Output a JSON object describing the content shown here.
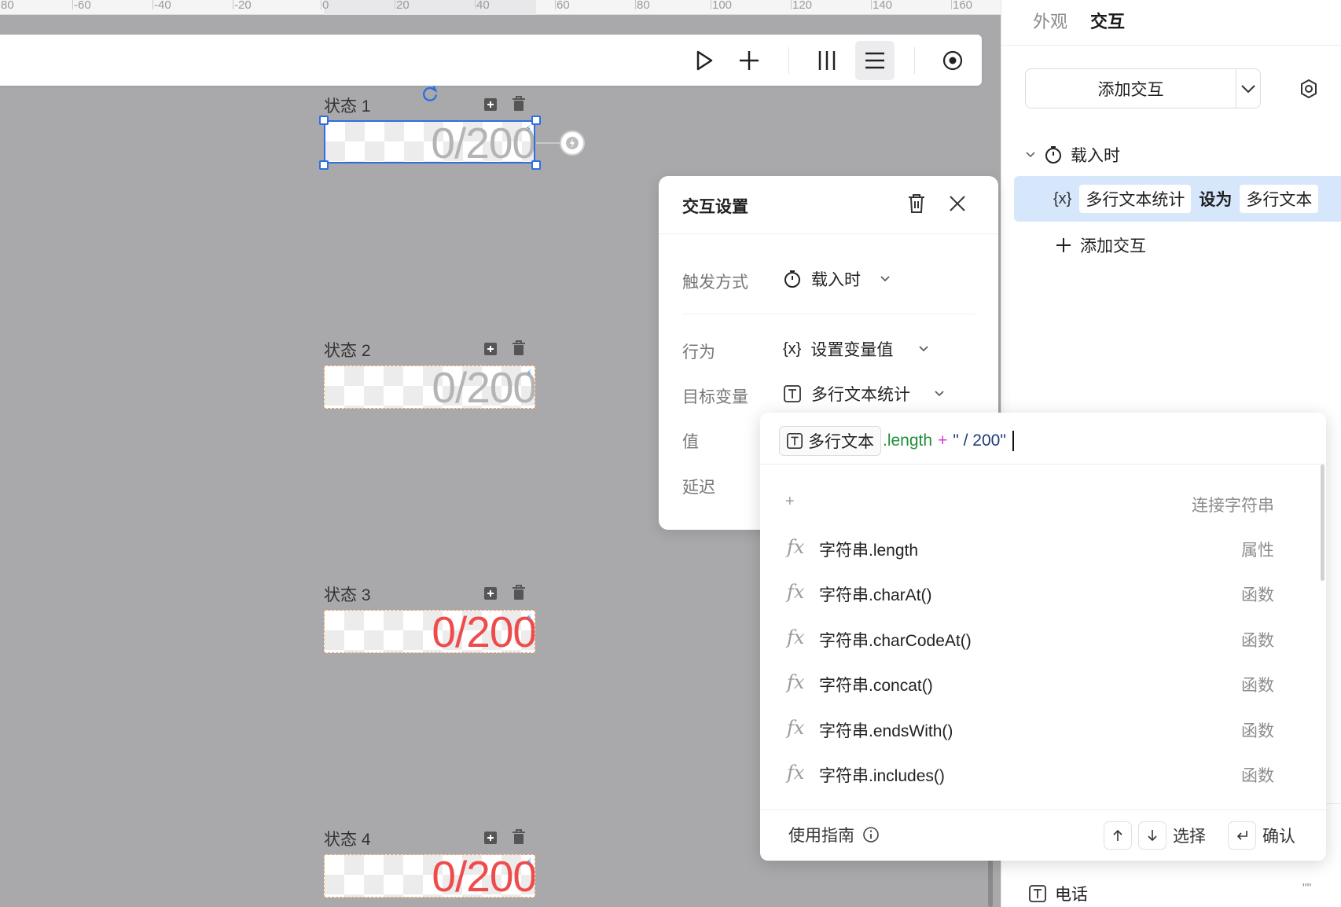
{
  "ruler": {
    "ticks": [
      "80",
      "-60",
      "-40",
      "-20",
      "0",
      "20",
      "40",
      "60",
      "80",
      "100",
      "120",
      "140",
      "160"
    ]
  },
  "states": [
    {
      "label": "状态 1",
      "counter": "0/200"
    },
    {
      "label": "状态 2",
      "counter": "0/200"
    },
    {
      "label": "状态 3",
      "counter": "0/200"
    },
    {
      "label": "状态 4",
      "counter": "0/200"
    }
  ],
  "right_panel": {
    "tabs": [
      "外观",
      "交互"
    ],
    "add_button": "添加交互",
    "trigger": "载入时",
    "action": {
      "icon_text": "{x}",
      "variable": "多行文本统计",
      "verb": "设为",
      "target": "多行文本"
    },
    "add_link": "添加交互",
    "bottom_item": {
      "label": "电话",
      "suffix": "\"\""
    }
  },
  "dialog": {
    "title": "交互设置",
    "trigger_label": "触发方式",
    "trigger_value": "载入时",
    "action_label": "行为",
    "action_icon": "{x}",
    "action_value": "设置变量值",
    "target_label": "目标变量",
    "target_value": "多行文本统计",
    "value_label": "值",
    "delay_label": "延迟"
  },
  "expression": {
    "token": "多行文本",
    "property": ".length",
    "operator": "+",
    "literal": "\" / 200\""
  },
  "suggestions": [
    {
      "icon": "+",
      "name": "",
      "type": "连接字符串"
    },
    {
      "icon": "fx",
      "name": "字符串.length",
      "type": "属性"
    },
    {
      "icon": "fx",
      "name": "字符串.charAt()",
      "type": "函数"
    },
    {
      "icon": "fx",
      "name": "字符串.charCodeAt()",
      "type": "函数"
    },
    {
      "icon": "fx",
      "name": "字符串.concat()",
      "type": "函数"
    },
    {
      "icon": "fx",
      "name": "字符串.endsWith()",
      "type": "函数"
    },
    {
      "icon": "fx",
      "name": "字符串.includes()",
      "type": "函数"
    }
  ],
  "footer": {
    "guide": "使用指南",
    "select": "选择",
    "confirm": "确认"
  },
  "colors": {
    "accent": "#2f6ee0",
    "highlight_row": "#d6e6fb",
    "counter_red": "#ef4b4b",
    "counter_gray": "#b4b4b4",
    "property_green": "#1f8f3a",
    "operator_pink": "#d63ad6",
    "literal_navy": "#1f3a7a"
  }
}
